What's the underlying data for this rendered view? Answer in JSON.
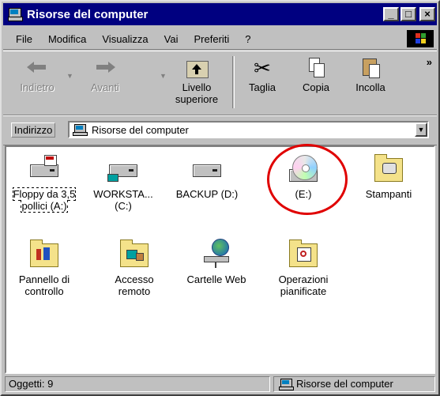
{
  "window": {
    "title": "Risorse del computer",
    "buttons": {
      "minimize": "_",
      "maximize": "□",
      "close": "×"
    }
  },
  "menu": [
    {
      "label": "File"
    },
    {
      "label": "Modifica"
    },
    {
      "label": "Visualizza"
    },
    {
      "label": "Vai"
    },
    {
      "label": "Preferiti"
    },
    {
      "label": "?"
    }
  ],
  "toolbar": {
    "back": "Indietro",
    "forward": "Avanti",
    "up_line1": "Livello",
    "up_line2": "superiore",
    "cut": "Taglia",
    "copy": "Copia",
    "paste": "Incolla",
    "more": "»"
  },
  "address": {
    "label": "Indirizzo",
    "value": "Risorse del computer"
  },
  "items": [
    {
      "line1": "Floppy da 3,5",
      "line2": "pollici (A:)"
    },
    {
      "line1": "WORKSTA...",
      "line2": "(C:)"
    },
    {
      "line1": "BACKUP (D:)",
      "line2": ""
    },
    {
      "line1": "(E:)",
      "line2": ""
    },
    {
      "line1": "Stampanti",
      "line2": ""
    },
    {
      "line1": "Pannello di",
      "line2": "controllo"
    },
    {
      "line1": "Accesso",
      "line2": "remoto"
    },
    {
      "line1": "Cartelle Web",
      "line2": ""
    },
    {
      "line1": "Operazioni",
      "line2": "pianificate"
    }
  ],
  "status": {
    "left": "Oggetti: 9",
    "right": "Risorse del computer"
  },
  "colors": {
    "titlebar": "#000080",
    "highlight_circle": "#e00000",
    "face": "#c0c0c0"
  }
}
